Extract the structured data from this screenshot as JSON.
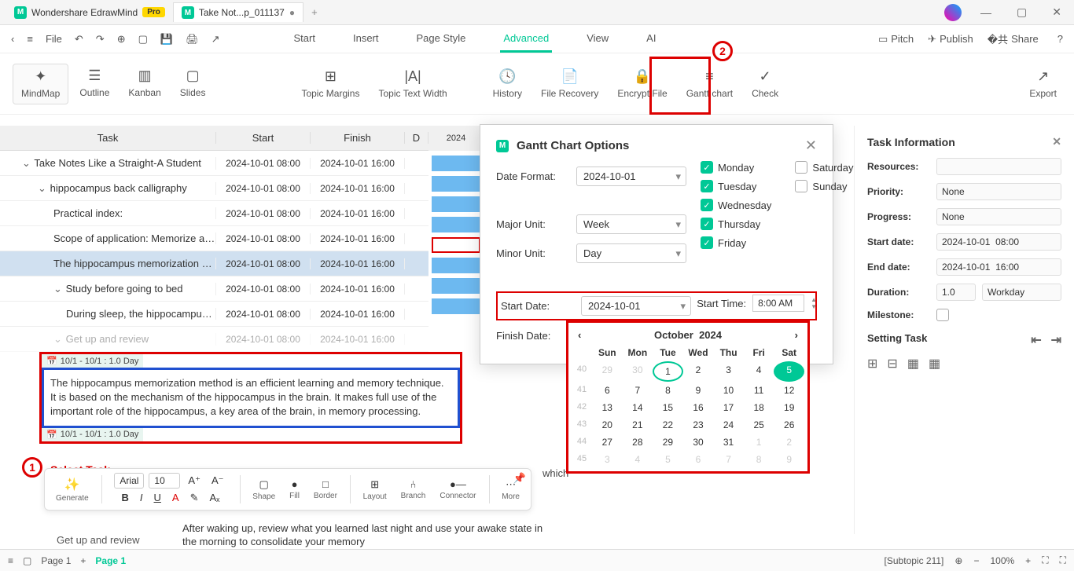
{
  "titlebar": {
    "appName": "Wondershare EdrawMind",
    "pro": "Pro",
    "docTab": "Take Not...p_011137",
    "dot": "●"
  },
  "menubar": {
    "file": "File",
    "tabs": [
      "Start",
      "Insert",
      "Page Style",
      "Advanced",
      "View",
      "AI"
    ],
    "right": {
      "pitch": "Pitch",
      "publish": "Publish",
      "share": "Share"
    }
  },
  "ribbon": {
    "mindmap": "MindMap",
    "outline": "Outline",
    "kanban": "Kanban",
    "slides": "Slides",
    "topicMargins": "Topic Margins",
    "topicTextWidth": "Topic Text Width",
    "history": "History",
    "fileRecovery": "File Recovery",
    "encrypt": "Encrypt File",
    "gantt": "Gantt chart",
    "check": "Check",
    "export": "Export"
  },
  "grid": {
    "headers": {
      "task": "Task",
      "start": "Start",
      "finish": "Finish",
      "d": "D"
    },
    "date": "2024",
    "rows": [
      {
        "task": "Take Notes Like a Straight-A Student",
        "start": "2024-10-01 08:00",
        "finish": "2024-10-01 16:00",
        "indent": 1,
        "chev": true
      },
      {
        "task": "hippocampus back calligraphy",
        "start": "2024-10-01 08:00",
        "finish": "2024-10-01 16:00",
        "indent": 2,
        "chev": true
      },
      {
        "task": "Practical index:",
        "start": "2024-10-01 08:00",
        "finish": "2024-10-01 16:00",
        "indent": 3
      },
      {
        "task": "Scope of application: Memorize all t...",
        "start": "2024-10-01 08:00",
        "finish": "2024-10-01 16:00",
        "indent": 3
      },
      {
        "task": "The hippocampus memorization me...",
        "start": "2024-10-01 08:00",
        "finish": "2024-10-01 16:00",
        "indent": 3,
        "sel": true
      },
      {
        "task": "Study before going to bed",
        "start": "2024-10-01 08:00",
        "finish": "2024-10-01 16:00",
        "indent": 3,
        "chev": true
      },
      {
        "task": "During sleep, the hippocampus ...",
        "start": "2024-10-01 08:00",
        "finish": "2024-10-01 16:00",
        "indent": 4
      },
      {
        "task": "Get up and review",
        "start": "2024-10-01 08:00",
        "finish": "2024-10-01 16:00",
        "indent": 3,
        "chev": true,
        "dim": true
      }
    ]
  },
  "dialog": {
    "title": "Gantt Chart Options",
    "dateFormat": {
      "label": "Date Format:",
      "value": "2024-10-01"
    },
    "majorUnit": {
      "label": "Major Unit:",
      "value": "Week"
    },
    "minorUnit": {
      "label": "Minor Unit:",
      "value": "Day"
    },
    "startDate": {
      "label": "Start Date:",
      "value": "2024-10-01"
    },
    "finishDate": {
      "label": "Finish Date:"
    },
    "startTime": {
      "label": "Start Time:",
      "value": "8:00 AM"
    },
    "days": {
      "mon": "Monday",
      "tue": "Tuesday",
      "wed": "Wednesday",
      "thu": "Thursday",
      "fri": "Friday",
      "sat": "Saturday",
      "sun": "Sunday"
    }
  },
  "calendar": {
    "month": "October",
    "year": "2024",
    "dow": [
      "Sun",
      "Mon",
      "Tue",
      "Wed",
      "Thu",
      "Fri",
      "Sat"
    ],
    "weeks": [
      "40",
      "41",
      "42",
      "43",
      "44",
      "45"
    ]
  },
  "rightPanel": {
    "title": "Task Information",
    "resources": "Resources:",
    "priority": {
      "label": "Priority:",
      "value": "None"
    },
    "progress": {
      "label": "Progress:",
      "value": "None"
    },
    "startDate": {
      "label": "Start date:",
      "d": "2024-10-01",
      "t": "08:00"
    },
    "endDate": {
      "label": "End date:",
      "d": "2024-10-01",
      "t": "16:00"
    },
    "duration": {
      "label": "Duration:",
      "v": "1.0",
      "u": "Workday"
    },
    "milestone": "Milestone:",
    "settingTask": "Setting Task"
  },
  "node": {
    "range1": "10/1 - 10/1 : 1.0 Day",
    "text": "The hippocampus memorization method is an efficient learning and memory technique. It is based on the mechanism of the hippocampus in the brain. It makes full use of the important role of the hippocampus, a key area of the brain, in memory processing.",
    "range2": "10/1 - 10/1 : 1.0 Day",
    "selectTask": "Select Task"
  },
  "fmt": {
    "generate": "Generate",
    "font": "Arial",
    "size": "10",
    "shape": "Shape",
    "fill": "Fill",
    "border": "Border",
    "layout": "Layout",
    "branch": "Branch",
    "connector": "Connector",
    "more": "More"
  },
  "freeText": {
    "afterWaking": "After waking up, review what you learned last night and use your awake state in the morning to consolidate your memory",
    "getUp": "Get up and review",
    "which": "which"
  },
  "statusbar": {
    "page1": "Page 1",
    "page1b": "Page 1",
    "subtopic": "[Subtopic 211]",
    "zoom": "100%"
  }
}
